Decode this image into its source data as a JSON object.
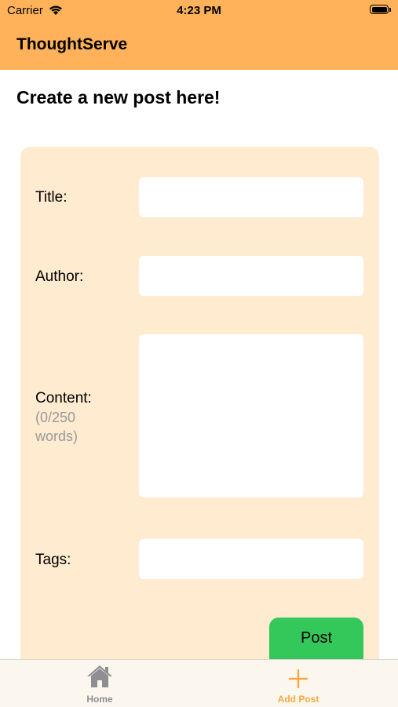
{
  "status_bar": {
    "carrier": "Carrier",
    "time": "4:23 PM"
  },
  "header": {
    "title": "ThoughtServe"
  },
  "page": {
    "heading": "Create a new post here!"
  },
  "form": {
    "title_label": "Title:",
    "author_label": "Author:",
    "content_label": "Content:",
    "content_hint_line1": "(0/250",
    "content_hint_line2": "words)",
    "tags_label": "Tags:",
    "title_value": "",
    "author_value": "",
    "content_value": "",
    "tags_value": "",
    "post_button": "Post"
  },
  "tab_bar": {
    "items": [
      {
        "label": "Home",
        "icon": "house-icon",
        "active": false
      },
      {
        "label": "Add Post",
        "icon": "plus-icon",
        "active": true
      }
    ]
  },
  "colors": {
    "header_bg": "#FFB259",
    "card_bg": "#FEEBD0",
    "post_button_bg": "#34C759",
    "tab_active": "#F5A940",
    "tab_inactive": "#8E8E93",
    "hint_text": "#999999"
  }
}
